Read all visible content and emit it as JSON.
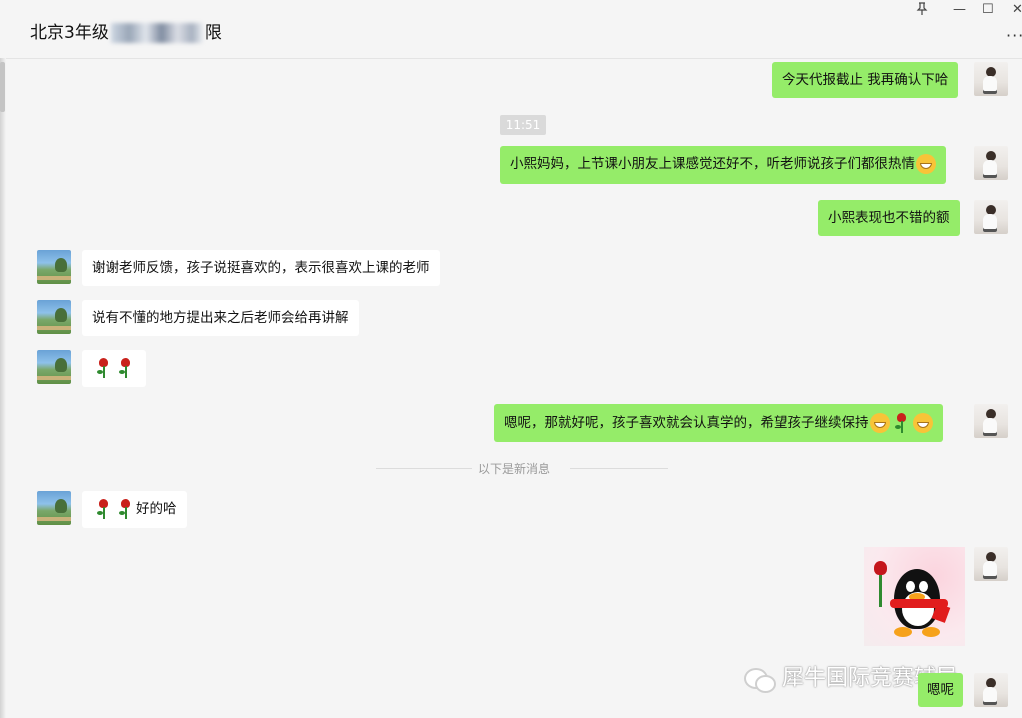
{
  "window": {
    "title_prefix": "北京3年级",
    "title_suffix": "限",
    "pin_icon": "pin-icon",
    "minimize_symbol": "—",
    "maximize_symbol": "☐",
    "close_symbol": "✕",
    "more_symbol": "···"
  },
  "messages": {
    "m1": "今天代报截止 我再确认下哈",
    "time": "11:51",
    "m2": "小熙妈妈，上节课小朋友上课感觉还好不，听老师说孩子们都很热情",
    "m3": "小熙表现也不错的额",
    "m4": "谢谢老师反馈，孩子说挺喜欢的，表示很喜欢上课的老师",
    "m5": "说有不懂的地方提出来之后老师会给再讲解",
    "m7": "嗯呢，那就好呢，孩子喜欢就会认真学的，希望孩子继续保持",
    "new_divider": "以下是新消息",
    "m8": "好的哈",
    "m10": "嗯呢"
  },
  "watermark": {
    "text": "犀牛国际竞赛辅导"
  },
  "colors": {
    "sent_bubble": "#95ec69",
    "received_bubble": "#ffffff",
    "background": "#f5f5f5"
  }
}
